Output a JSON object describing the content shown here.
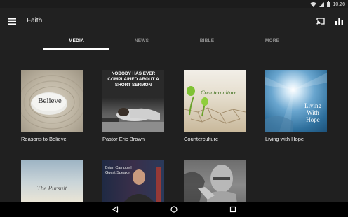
{
  "status": {
    "time": "10:26"
  },
  "app": {
    "title": "Faith"
  },
  "tabs": [
    {
      "label": "MEDIA",
      "active": true
    },
    {
      "label": "NEWS",
      "active": false
    },
    {
      "label": "BIBLE",
      "active": false
    },
    {
      "label": "MORE",
      "active": false
    }
  ],
  "cards": [
    {
      "title": "Reasons to Believe",
      "thumb_text": "Believe"
    },
    {
      "title": "Pastor Eric Brown",
      "thumb_text": "NOBODY HAS EVER COMPLAINED ABOUT A SHORT SERMON"
    },
    {
      "title": "Counterculture",
      "thumb_text": "Counterculture"
    },
    {
      "title": "Living with Hope",
      "thumb_text": "Living With Hope"
    },
    {
      "title": "",
      "thumb_text": "The Pursuit"
    },
    {
      "title": "",
      "thumb_text": "Brian Campbell Guest Speaker"
    },
    {
      "title": "",
      "thumb_text": ""
    }
  ],
  "icons": {
    "menu": "menu-icon",
    "cast": "cast-icon",
    "stats": "bar-chart-icon",
    "back": "back-triangle-icon",
    "home": "home-circle-icon",
    "recents": "recents-square-icon"
  },
  "colors": {
    "app_bar": "#212121",
    "content_bg": "#202020",
    "tab_inactive": "#8f8f8f"
  }
}
